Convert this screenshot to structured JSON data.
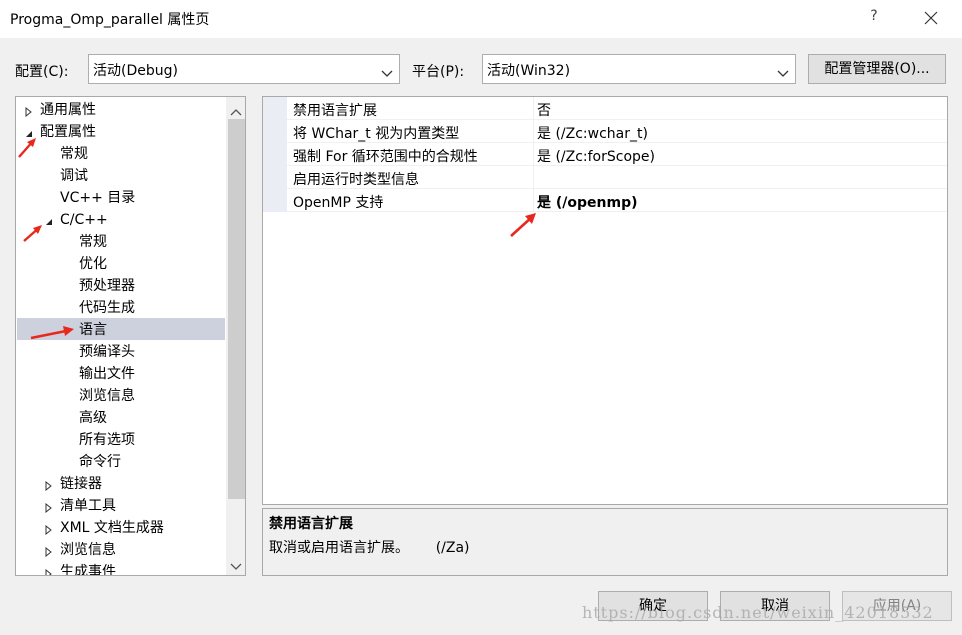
{
  "window": {
    "title": "Progma_Omp_parallel 属性页",
    "help_label": "?",
    "close_icon": "close-icon"
  },
  "toolbar": {
    "config_label": "配置(C):",
    "config_value": "活动(Debug)",
    "platform_label": "平台(P):",
    "platform_value": "活动(Win32)",
    "config_manager_label": "配置管理器(O)..."
  },
  "tree": {
    "items": [
      {
        "label": "通用属性",
        "expander": "collapsed"
      },
      {
        "label": "配置属性",
        "expander": "expanded"
      },
      {
        "label": "常规"
      },
      {
        "label": "调试"
      },
      {
        "label": "VC++ 目录"
      },
      {
        "label": "C/C++",
        "expander": "expanded"
      },
      {
        "label": "常规"
      },
      {
        "label": "优化"
      },
      {
        "label": "预处理器"
      },
      {
        "label": "代码生成"
      },
      {
        "label": "语言",
        "selected": true
      },
      {
        "label": "预编译头"
      },
      {
        "label": "输出文件"
      },
      {
        "label": "浏览信息"
      },
      {
        "label": "高级"
      },
      {
        "label": "所有选项"
      },
      {
        "label": "命令行"
      },
      {
        "label": "链接器",
        "expander": "collapsed"
      },
      {
        "label": "清单工具",
        "expander": "collapsed"
      },
      {
        "label": "XML 文档生成器",
        "expander": "collapsed"
      },
      {
        "label": "浏览信息",
        "expander": "collapsed"
      },
      {
        "label": "生成事件",
        "expander": "collapsed"
      }
    ],
    "selection_color": "#cdd0dd"
  },
  "properties": [
    {
      "name": "禁用语言扩展",
      "value": "否"
    },
    {
      "name": "将 WChar_t 视为内置类型",
      "value": "是 (/Zc:wchar_t)"
    },
    {
      "name": "强制 For 循环范围中的合规性",
      "value": "是 (/Zc:forScope)"
    },
    {
      "name": "启用运行时类型信息",
      "value": ""
    },
    {
      "name": "OpenMP 支持",
      "value": "是 (/openmp)",
      "bold": true
    }
  ],
  "description": {
    "title": "禁用语言扩展",
    "text": "取消或启用语言扩展。      (/Za)"
  },
  "buttons": {
    "ok": "确定",
    "cancel": "取消",
    "apply": "应用(A)"
  },
  "watermark": "https://blog.csdn.net/weixin_42018532",
  "colors": {
    "annotation_arrow": "#e8281e",
    "gutter": "#ebedf5"
  }
}
